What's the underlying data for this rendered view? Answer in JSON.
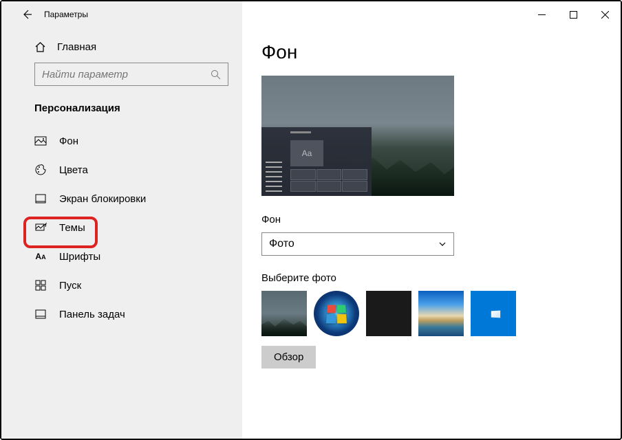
{
  "titlebar": {
    "title": "Параметры"
  },
  "sidebar": {
    "home": "Главная",
    "search_placeholder": "Найти параметр",
    "section": "Персонализация",
    "items": [
      {
        "label": "Фон",
        "icon": "picture-icon"
      },
      {
        "label": "Цвета",
        "icon": "palette-icon",
        "highlighted": true
      },
      {
        "label": "Экран блокировки",
        "icon": "lockscreen-icon"
      },
      {
        "label": "Темы",
        "icon": "themes-icon"
      },
      {
        "label": "Шрифты",
        "icon": "fonts-icon"
      },
      {
        "label": "Пуск",
        "icon": "start-icon"
      },
      {
        "label": "Панель задач",
        "icon": "taskbar-icon"
      }
    ]
  },
  "main": {
    "title": "Фон",
    "preview_aa": "Aa",
    "bg_label": "Фон",
    "bg_value": "Фото",
    "choose_label": "Выберите фото",
    "browse": "Обзор"
  }
}
